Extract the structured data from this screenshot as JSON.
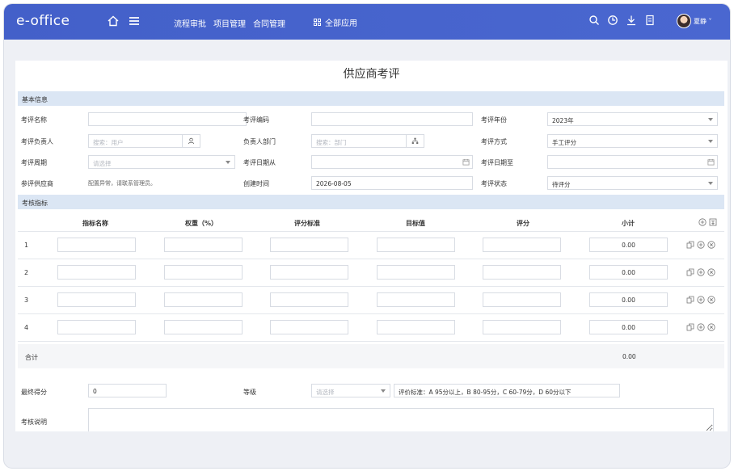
{
  "app": {
    "logo": "e-office",
    "nav": [
      "流程审批",
      "项目管理",
      "合同管理"
    ],
    "all_apps": "全部应用",
    "user": "夏静"
  },
  "page": {
    "title": "供应商考评"
  },
  "basic": {
    "section": "基本信息",
    "name_label": "考评名称",
    "code_label": "考评编码",
    "year_label": "考评年份",
    "year_value": "2023年",
    "owner_label": "考评负责人",
    "owner_placeholder": "搜索：用户",
    "dept_label": "负责人部门",
    "dept_placeholder": "搜索：部门",
    "method_label": "考评方式",
    "method_value": "手工评分",
    "period_label": "考评周期",
    "period_placeholder": "请选择",
    "date_from_label": "考评日期从",
    "date_to_label": "考评日期至",
    "supplier_label": "参评供应商",
    "supplier_hint": "配置异常，请联系管理员。",
    "created_label": "创建时间",
    "created_value": "2026-08-05",
    "status_label": "考评状态",
    "status_value": "待评分"
  },
  "indicators": {
    "section": "考核指标",
    "headers": [
      "指标名称",
      "权重（%）",
      "评分标准",
      "目标值",
      "评分",
      "小计"
    ],
    "rows": [
      {
        "no": "1",
        "subtotal": "0.00"
      },
      {
        "no": "2",
        "subtotal": "0.00"
      },
      {
        "no": "3",
        "subtotal": "0.00"
      },
      {
        "no": "4",
        "subtotal": "0.00"
      }
    ],
    "total_label": "合计",
    "total_value": "0.00"
  },
  "result": {
    "score_label": "最终得分",
    "score_value": "0",
    "grade_label": "等级",
    "grade_placeholder": "请选择",
    "grade_standard": "评价标准：A 95分以上，B 80-95分，C 60-79分，D 60分以下",
    "remark_label": "考核说明"
  }
}
